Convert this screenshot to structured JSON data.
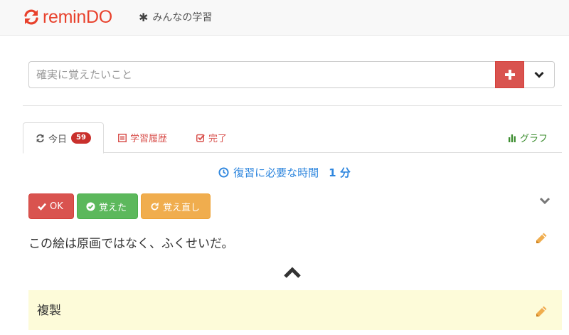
{
  "navbar": {
    "brand": "reminDO",
    "nav_link": "みんなの学習"
  },
  "input": {
    "placeholder": "確実に覚えたいこと",
    "value": ""
  },
  "tabs": {
    "today": {
      "label": "今日",
      "badge": "59"
    },
    "history": {
      "label": "学習履歴"
    },
    "done": {
      "label": "完了"
    },
    "graph": {
      "label": "グラフ"
    }
  },
  "review": {
    "label": "復習に必要な時間",
    "value": "1 分"
  },
  "buttons": {
    "ok": "OK",
    "learned": "覚えた",
    "relearn": "覚え直し"
  },
  "card": {
    "question": "この絵は原画ではなく、ふくせいだ。",
    "answer": "複製"
  },
  "colors": {
    "brand": "#e8412c",
    "danger": "#d9534f",
    "success": "#5cb85c",
    "warning": "#f0ad4e",
    "info": "#2e86de",
    "graph": "#3c8d2f",
    "answer_bg": "#fdfbd9"
  },
  "icons": {
    "brand": "refresh-icon",
    "nav": "asterisk-icon",
    "add": "plus-icon",
    "dropdown": "chevron-down-icon",
    "today": "refresh-icon",
    "history": "list-icon",
    "done": "check-square-icon",
    "graph": "bar-chart-icon",
    "review": "clock-icon",
    "ok": "check-icon",
    "learned": "check-circle-icon",
    "relearn": "refresh-icon",
    "collapse": "chevron-down-icon",
    "edit": "pencil-icon",
    "expand": "chevron-up-icon"
  }
}
